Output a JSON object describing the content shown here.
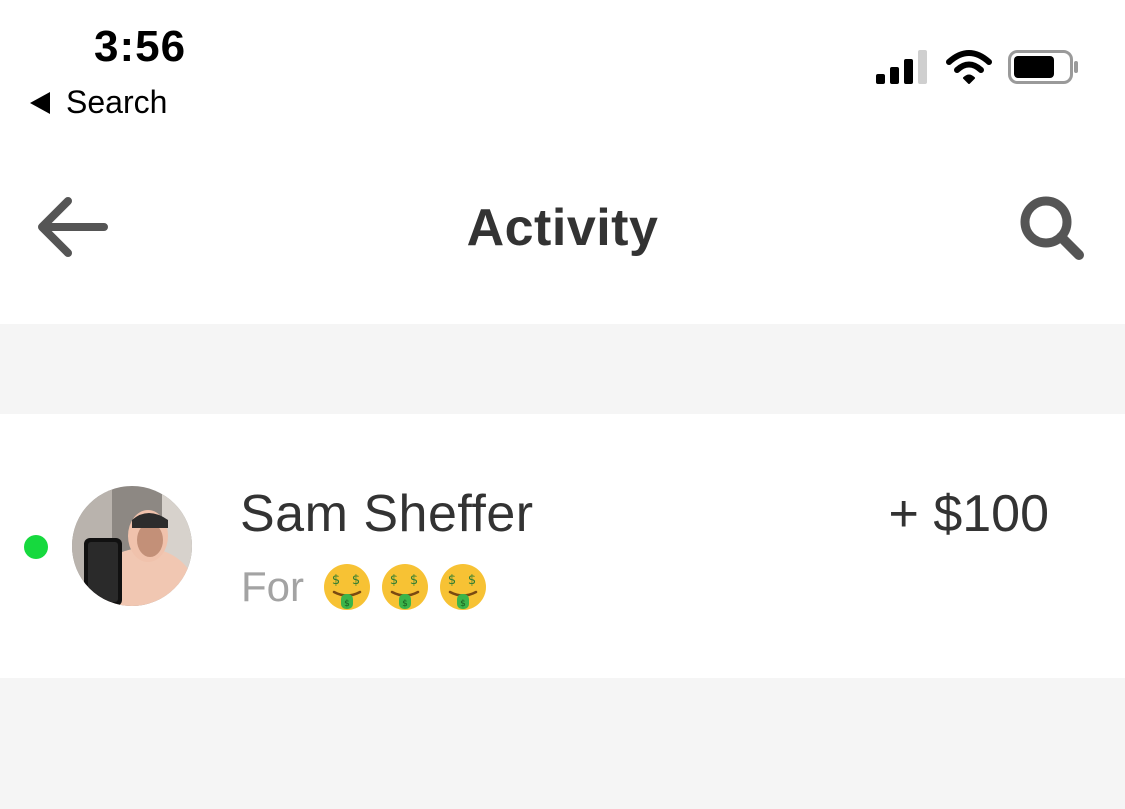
{
  "status_bar": {
    "time": "3:56",
    "back_app_label": "Search",
    "icons": [
      "signal-icon",
      "wifi-icon",
      "battery-icon"
    ]
  },
  "nav": {
    "title": "Activity",
    "back_icon": "arrow-left-icon",
    "search_icon": "search-icon"
  },
  "activity": [
    {
      "name": "Sam Sheffer",
      "note_prefix": "For",
      "note_emoji": [
        "money-mouth-face",
        "money-mouth-face",
        "money-mouth-face"
      ],
      "amount": "+ $100",
      "unread": true
    }
  ],
  "colors": {
    "unread_dot": "#16d93e",
    "text_primary": "#333333",
    "text_secondary": "#a3a3a3",
    "band": "#f5f5f5"
  }
}
